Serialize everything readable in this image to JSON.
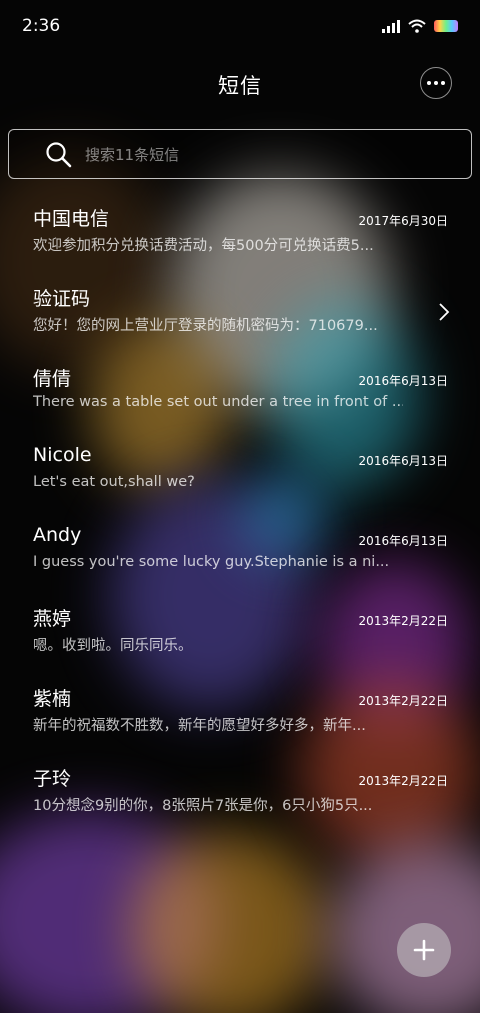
{
  "status_bar": {
    "time": "2:36"
  },
  "header": {
    "title": "短信",
    "more_icon": "more-horizontal-icon"
  },
  "search": {
    "placeholder": "搜索11条短信",
    "icon": "search-icon"
  },
  "conversations": [
    {
      "name": "中国电信",
      "date": "2017年6月30日",
      "preview": "欢迎参加积分兑换话费活动，每500分可兑换话费5..."
    },
    {
      "name": "验证码",
      "date": "",
      "preview": "您好！您的网上营业厅登录的随机密码为：710679..."
    },
    {
      "name": "倩倩",
      "date": "2016年6月13日",
      "preview": "There was a table set out under a tree in front of ..."
    },
    {
      "name": "Nicole",
      "date": "2016年6月13日",
      "preview": "Let's eat out,shall we?"
    },
    {
      "name": "Andy",
      "date": "2016年6月13日",
      "preview": "I guess you're some lucky guy.Stephanie is a ni..."
    },
    {
      "name": "燕婷",
      "date": "2013年2月22日",
      "preview": "嗯。收到啦。同乐同乐。"
    },
    {
      "name": "紫楠",
      "date": "2013年2月22日",
      "preview": "新年的祝福数不胜数，新年的愿望好多好多，新年..."
    },
    {
      "name": "子玲",
      "date": "2013年2月22日",
      "preview": "10分想念9别的你，8张照片7张是你，6只小狗5只..."
    }
  ],
  "fab": {
    "icon": "plus-icon"
  }
}
